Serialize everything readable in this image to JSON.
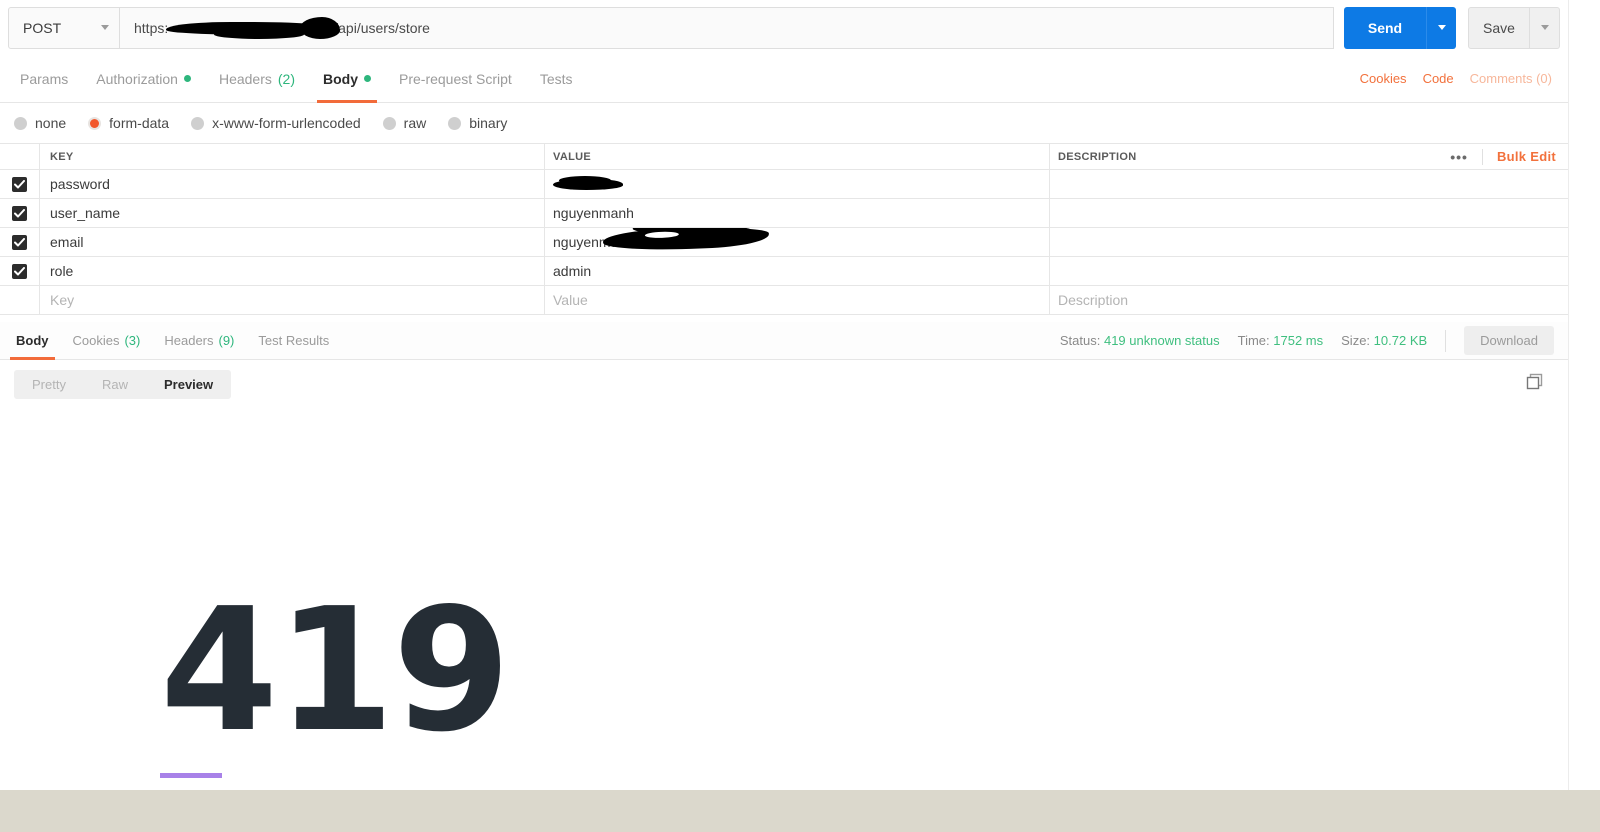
{
  "request": {
    "method": "POST",
    "url_prefix": "https:",
    "url_suffix": "/api/users/store",
    "send_label": "Send",
    "save_label": "Save"
  },
  "request_tabs": [
    {
      "label": "Params",
      "badge": "",
      "badge_type": "none",
      "active": false
    },
    {
      "label": "Authorization",
      "badge": "",
      "badge_type": "dot",
      "active": false
    },
    {
      "label": "Headers",
      "badge": "(2)",
      "badge_type": "count",
      "active": false
    },
    {
      "label": "Body",
      "badge": "",
      "badge_type": "dot",
      "active": true
    },
    {
      "label": "Pre-request Script",
      "badge": "",
      "badge_type": "none",
      "active": false
    },
    {
      "label": "Tests",
      "badge": "",
      "badge_type": "none",
      "active": false
    }
  ],
  "request_tabs_right": {
    "cookies": "Cookies",
    "code": "Code",
    "comments": "Comments (0)"
  },
  "body_types": [
    {
      "label": "none",
      "selected": false
    },
    {
      "label": "form-data",
      "selected": true
    },
    {
      "label": "x-www-form-urlencoded",
      "selected": false
    },
    {
      "label": "raw",
      "selected": false
    },
    {
      "label": "binary",
      "selected": false
    }
  ],
  "kv_table": {
    "headers": {
      "key": "KEY",
      "value": "VALUE",
      "description": "DESCRIPTION"
    },
    "bulk_edit_label": "Bulk Edit",
    "rows": [
      {
        "checked": true,
        "key": "password",
        "value": "",
        "value_redacted": "password",
        "description": ""
      },
      {
        "checked": true,
        "key": "user_name",
        "value": "nguyenmanh",
        "value_redacted": "",
        "description": ""
      },
      {
        "checked": true,
        "key": "email",
        "value": "nguyenman",
        "value_redacted": "email",
        "description": ""
      },
      {
        "checked": true,
        "key": "role",
        "value": "admin",
        "value_redacted": "",
        "description": ""
      }
    ],
    "placeholder_row": {
      "key": "Key",
      "value": "Value",
      "description": "Description"
    }
  },
  "response_tabs": [
    {
      "label": "Body",
      "badge": "",
      "active": true
    },
    {
      "label": "Cookies",
      "badge": "(3)",
      "active": false
    },
    {
      "label": "Headers",
      "badge": "(9)",
      "active": false
    },
    {
      "label": "Test Results",
      "badge": "",
      "active": false
    }
  ],
  "response_meta": {
    "status_label": "Status:",
    "status_value": "419 unknown status",
    "time_label": "Time:",
    "time_value": "1752 ms",
    "size_label": "Size:",
    "size_value": "10.72 KB",
    "download_label": "Download"
  },
  "preview_toggle": [
    {
      "label": "Pretty",
      "active": false
    },
    {
      "label": "Raw",
      "active": false
    },
    {
      "label": "Preview",
      "active": true
    }
  ],
  "preview_content": {
    "error_code": "419"
  },
  "colors": {
    "accent_orange": "#f26b3a",
    "link_orange": "#f2713c",
    "send_blue": "#0d7ae5",
    "status_green": "#3fbf7f",
    "dot_green": "#2eb67d",
    "purple_rule": "#a881e8",
    "error_text": "#252d35",
    "footer_beige": "#dbd8cc"
  }
}
